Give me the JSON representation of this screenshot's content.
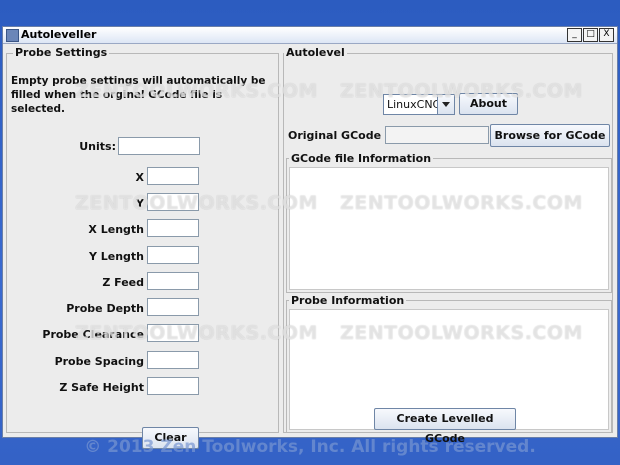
{
  "window": {
    "title": "Autoleveller",
    "controls": [
      "_",
      "□",
      "X"
    ]
  },
  "probe_settings": {
    "title": "Probe Settings",
    "note": "Empty probe settings will automatically be filled when the orginal GCode file is selected.",
    "fields": [
      {
        "label": "Units:",
        "value": ""
      },
      {
        "label": "X",
        "value": ""
      },
      {
        "label": "Y",
        "value": ""
      },
      {
        "label": "X Length",
        "value": ""
      },
      {
        "label": "Y Length",
        "value": ""
      },
      {
        "label": "Z Feed",
        "value": ""
      },
      {
        "label": "Probe Depth",
        "value": ""
      },
      {
        "label": "Probe Clearance",
        "value": ""
      },
      {
        "label": "Probe Spacing",
        "value": ""
      },
      {
        "label": "Z Safe Height",
        "value": ""
      }
    ],
    "clear_label": "Clear"
  },
  "autolevel": {
    "title": "Autolevel",
    "controller_selected": "LinuxCNC",
    "about_label": "About",
    "original_gcode_label": "Original GCode File",
    "browse_label": "Browse for GCode",
    "gcode_info_title": "GCode file Information",
    "probe_info_title": "Probe Information",
    "create_label": "Create Levelled GCode"
  },
  "watermark": {
    "text": "ZENTOOLWORKS.COM",
    "copyright": "© 2013 Zen Toolworks, Inc. All rights reserved."
  }
}
